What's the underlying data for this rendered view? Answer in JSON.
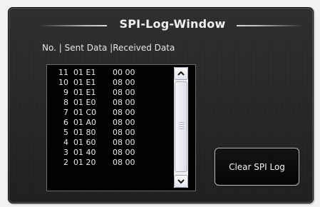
{
  "window": {
    "title": "SPI-Log-Window"
  },
  "log": {
    "header": "No. | Sent Data |Received Data",
    "rows": [
      {
        "no": "11",
        "sent": "01 E1",
        "received": "00 00"
      },
      {
        "no": "10",
        "sent": "01 E1",
        "received": "08 00"
      },
      {
        "no": "9",
        "sent": "01 E1",
        "received": "08 00"
      },
      {
        "no": "8",
        "sent": "01 E0",
        "received": "08 00"
      },
      {
        "no": "7",
        "sent": "01 C0",
        "received": "08 00"
      },
      {
        "no": "6",
        "sent": "01 A0",
        "received": "08 00"
      },
      {
        "no": "5",
        "sent": "01 80",
        "received": "08 00"
      },
      {
        "no": "4",
        "sent": "01 60",
        "received": "08 00"
      },
      {
        "no": "3",
        "sent": "01 40",
        "received": "08 00"
      },
      {
        "no": "2",
        "sent": "01 20",
        "received": "08 00"
      }
    ]
  },
  "actions": {
    "clear_label": "Clear SPI Log"
  },
  "colors": {
    "window_bg": "#262626",
    "list_bg": "#020202",
    "text": "#e8e8e8"
  }
}
